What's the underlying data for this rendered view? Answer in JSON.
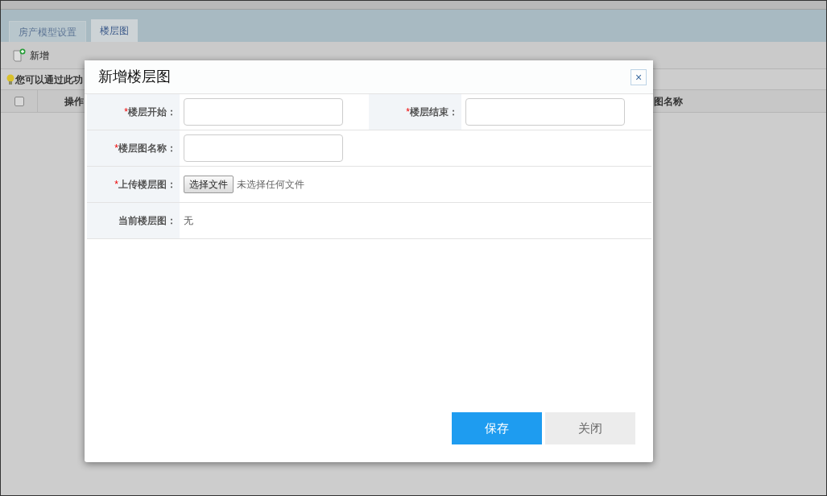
{
  "tabs": [
    {
      "label": "房产模型设置",
      "selected": false
    },
    {
      "label": "楼层图",
      "selected": true
    }
  ],
  "toolbar": {
    "add_button": "新增"
  },
  "hint": "您可以通过此功",
  "table": {
    "select_all": {
      "checked": false
    },
    "columns": [
      "操作",
      "图名称"
    ]
  },
  "dialog": {
    "title": "新增楼层图",
    "close": "×",
    "rows": [
      {
        "fields": [
          {
            "kind": "input",
            "label": "楼层开始：",
            "required_mark": "*"
          },
          {
            "kind": "input",
            "label": "楼层结束：",
            "required_mark": "*"
          }
        ]
      },
      {
        "fields": [
          {
            "kind": "input",
            "label": "楼层图名称：",
            "required_mark": "*"
          }
        ]
      },
      {
        "fields": [
          {
            "kind": "file",
            "label": "上传楼层图：",
            "required_mark": "*",
            "button": "选择文件",
            "status": "未选择任何文件"
          }
        ]
      },
      {
        "fields": [
          {
            "kind": "text",
            "label": "当前楼层图：",
            "value": "无"
          }
        ]
      }
    ],
    "buttons": [
      {
        "kind": "primary",
        "label": "保存"
      },
      {
        "kind": "secondary",
        "label": "关闭"
      }
    ]
  }
}
